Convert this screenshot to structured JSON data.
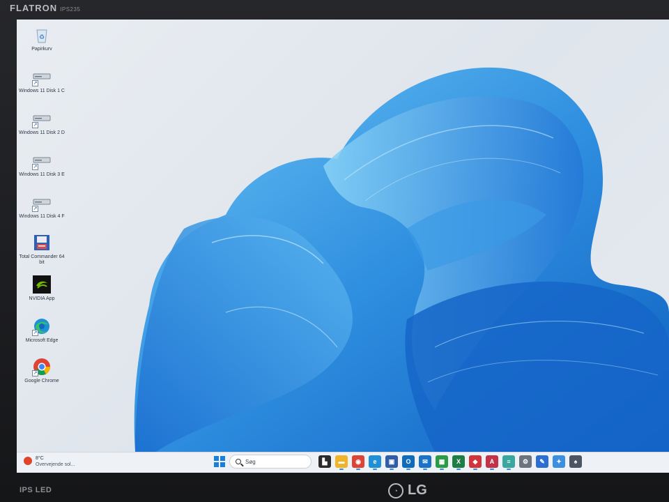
{
  "monitor": {
    "brand_top": "FLATRON",
    "model": "IPS235",
    "brand_bottom": "IPS LED",
    "logo_text": "LG"
  },
  "desktop": {
    "icons": [
      {
        "label": "Papirkurv",
        "icon": "recycle-bin-icon"
      },
      {
        "label": "Windows 11 Disk 1 C",
        "icon": "drive-icon"
      },
      {
        "label": "Windows 11 Disk 2 D",
        "icon": "drive-icon"
      },
      {
        "label": "Windows 11 Disk 3 E",
        "icon": "drive-icon"
      },
      {
        "label": "Windows 11 Disk 4 F",
        "icon": "drive-icon"
      },
      {
        "label": "Total Commander 64 bit",
        "icon": "total-commander-icon"
      },
      {
        "label": "NVIDIA App",
        "icon": "nvidia-icon"
      },
      {
        "label": "Microsoft Edge",
        "icon": "edge-icon"
      },
      {
        "label": "Google Chrome",
        "icon": "chrome-icon"
      }
    ]
  },
  "taskbar": {
    "weather": {
      "temp": "8°C",
      "condition": "Overvejende sol..."
    },
    "search_placeholder": "Søg",
    "apps": [
      {
        "name": "task-view",
        "color": "#2b2b2b",
        "glyph": "▙"
      },
      {
        "name": "file-explorer",
        "color": "#f0b429",
        "glyph": "▬"
      },
      {
        "name": "chrome",
        "color": "#db4437",
        "glyph": "◉"
      },
      {
        "name": "edge",
        "color": "#1f8fd6",
        "glyph": "e"
      },
      {
        "name": "save-app",
        "color": "#2f5da8",
        "glyph": "▣"
      },
      {
        "name": "outlook",
        "color": "#0f6cbd",
        "glyph": "O"
      },
      {
        "name": "mail",
        "color": "#1a73c9",
        "glyph": "✉"
      },
      {
        "name": "green-app",
        "color": "#2d9b46",
        "glyph": "▦"
      },
      {
        "name": "excel",
        "color": "#1d7d45",
        "glyph": "X"
      },
      {
        "name": "red-app",
        "color": "#d1343a",
        "glyph": "◆"
      },
      {
        "name": "access",
        "color": "#c2334a",
        "glyph": "A"
      },
      {
        "name": "notepad",
        "color": "#3aa6a0",
        "glyph": "≡"
      },
      {
        "name": "settings",
        "color": "#6c7480",
        "glyph": "⚙"
      },
      {
        "name": "paint",
        "color": "#2a6fd1",
        "glyph": "✎"
      },
      {
        "name": "photos",
        "color": "#3b8fe0",
        "glyph": "✦"
      },
      {
        "name": "solitaire",
        "color": "#4b5563",
        "glyph": "♠"
      }
    ]
  }
}
